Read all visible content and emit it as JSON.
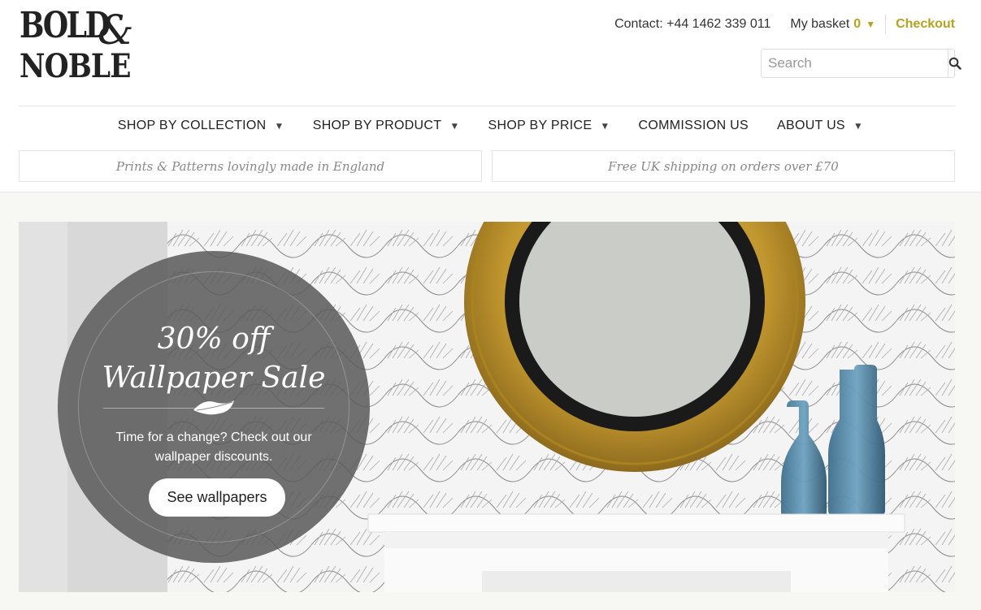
{
  "logo": {
    "line1": "BOLD",
    "amp": "&",
    "line2": "NOBLE"
  },
  "topbar": {
    "contact": "Contact: +44 1462 339 011",
    "basket_label": "My basket",
    "basket_count": "0",
    "checkout": "Checkout"
  },
  "search": {
    "placeholder": "Search"
  },
  "nav": {
    "items": [
      {
        "label": "SHOP BY COLLECTION",
        "dropdown": true
      },
      {
        "label": "SHOP BY PRODUCT",
        "dropdown": true
      },
      {
        "label": "SHOP BY PRICE",
        "dropdown": true
      },
      {
        "label": "COMMISSION US",
        "dropdown": false
      },
      {
        "label": "ABOUT US",
        "dropdown": true
      }
    ]
  },
  "promos": {
    "left": "Prints & Patterns lovingly made in England",
    "right": "Free UK shipping on orders over £70"
  },
  "hero": {
    "title_line1": "30% off",
    "title_line2": "Wallpaper Sale",
    "description": "Time for a change? Check out our wallpaper discounts.",
    "cta": "See wallpapers"
  },
  "colors": {
    "accent": "#b5a21e",
    "badge": "#5a5a5a",
    "page_bg": "#f7f8f3"
  },
  "icons": {
    "search": "search-icon",
    "caret": "chevron-down-icon",
    "leaf": "leaf-icon"
  }
}
